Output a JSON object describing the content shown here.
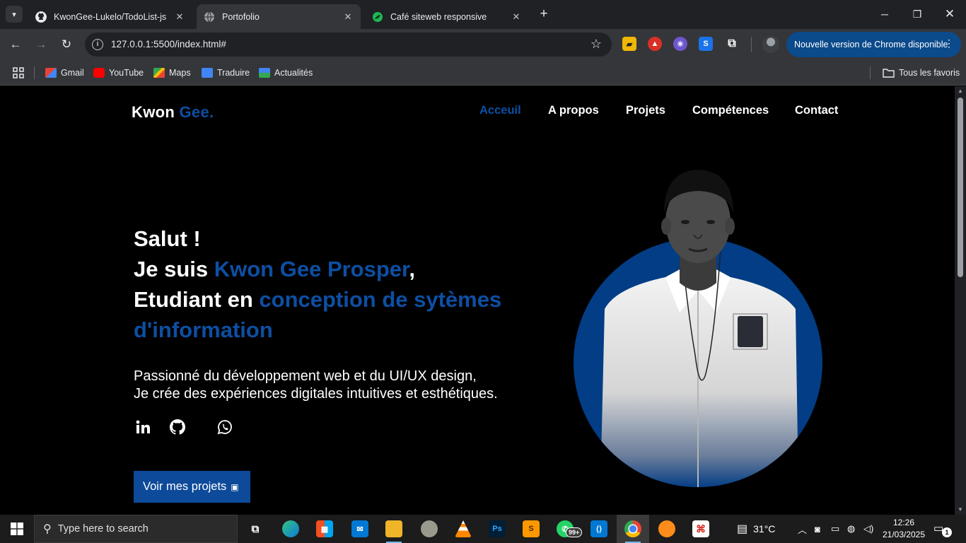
{
  "browser": {
    "tabs": [
      {
        "title": "KwonGee-Lukelo/TodoList-js",
        "icon": "github-icon",
        "active": false
      },
      {
        "title": "Portofolio",
        "icon": "globe-icon",
        "active": true
      },
      {
        "title": "Café siteweb responsive",
        "icon": "leaf-icon",
        "active": false
      }
    ],
    "url": "127.0.0.1:5500/index.html#",
    "update_label": "Nouvelle version de Chrome disponible",
    "bookmarks": [
      {
        "label": "Gmail",
        "icon": "gmail-icon"
      },
      {
        "label": "YouTube",
        "icon": "youtube-icon"
      },
      {
        "label": "Maps",
        "icon": "maps-icon"
      },
      {
        "label": "Traduire",
        "icon": "translate-icon"
      },
      {
        "label": "Actualités",
        "icon": "news-icon"
      }
    ],
    "all_bookmarks_label": "Tous les favoris"
  },
  "site": {
    "logo_main": "Kwon",
    "logo_accent": "Gee.",
    "nav": [
      "Acceuil",
      "A propos",
      "Projets",
      "Compétences",
      "Contact"
    ],
    "active_nav": "Acceuil",
    "hero": {
      "line1": "Salut !",
      "line2_prefix": "Je suis ",
      "line2_name": "Kwon Gee Prosper",
      "line2_suffix": ",",
      "line3_prefix": "Etudiant en ",
      "line3_accent": "conception de sytèmes d'information",
      "desc_line1": "Passionné du développement web et du UI/UX design,",
      "desc_line2": "Je crée des expériences digitales intuitives et esthétiques."
    },
    "social": [
      "linkedin-icon",
      "github-icon",
      "whatsapp-icon"
    ],
    "cta_label": "Voir mes projets",
    "accent_color": "#0d4fa3",
    "circle_color": "#023d85"
  },
  "taskbar": {
    "search_placeholder": "Type here to search",
    "apps": [
      "task-view",
      "edge",
      "store",
      "mail",
      "file-explorer",
      "gimp",
      "vlc",
      "photoshop",
      "sublime-text",
      "whatsapp",
      "vscode",
      "chrome",
      "scratch",
      "acrobat"
    ],
    "whatsapp_badge": "99+",
    "weather": "31°C",
    "time": "12:26",
    "date": "21/03/2025",
    "notifications": "1"
  }
}
